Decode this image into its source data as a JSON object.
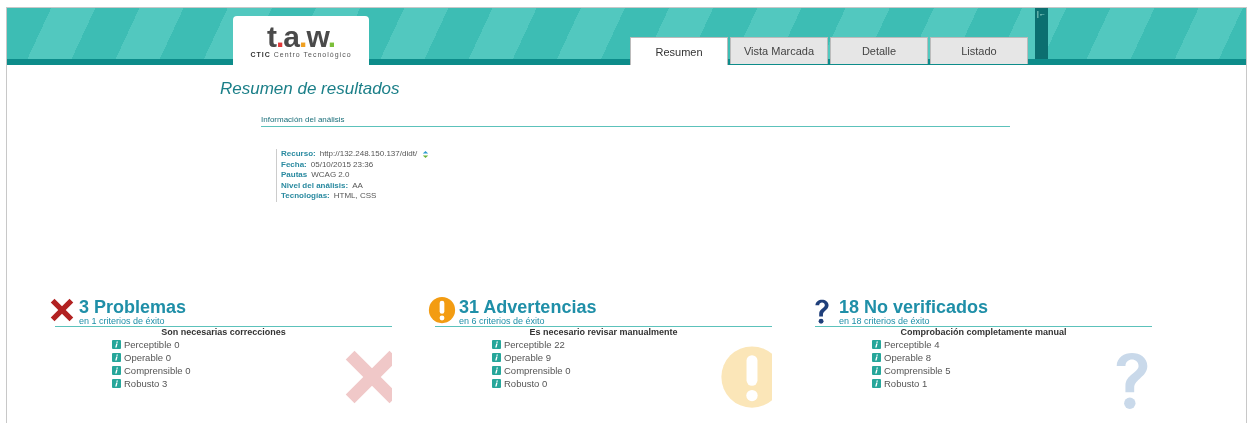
{
  "header": {
    "logo": {
      "wordmark_t": "t",
      "wordmark_dot1": ".",
      "wordmark_a": "a",
      "wordmark_dot2": ".",
      "wordmark_w": "w",
      "wordmark_dot3": ".",
      "tagline_bold": "CTIC",
      "tagline": "Centro Tecnológico"
    },
    "collapse_icon": "|←"
  },
  "tabs": [
    {
      "label": "Resumen",
      "selected": true
    },
    {
      "label": "Vista Marcada",
      "selected": false
    },
    {
      "label": "Detalle",
      "selected": false
    },
    {
      "label": "Listado",
      "selected": false
    }
  ],
  "title": "Resumen de resultados",
  "analysis_info": {
    "heading": "Información del análisis",
    "fields": [
      {
        "label": "Recurso:",
        "value": "http://132.248.150.137/didt/",
        "has_refresh": true
      },
      {
        "label": "Fecha:",
        "value": "05/10/2015 23:36",
        "has_refresh": false
      },
      {
        "label": "Pautas",
        "value": "WCAG 2.0",
        "has_refresh": false
      },
      {
        "label": "Nivel del análisis:",
        "value": "AA",
        "has_refresh": false
      },
      {
        "label": "Tecnologías:",
        "value": "HTML, CSS",
        "has_refresh": false
      }
    ]
  },
  "summaries": [
    {
      "kind": "error",
      "title": "3 Problemas",
      "subtitle": "en 1 criterios de éxito",
      "note": "Son necesarias correcciones",
      "items": [
        "Perceptible 0",
        "Operable 0",
        "Comprensible 0",
        "Robusto 3"
      ]
    },
    {
      "kind": "warning",
      "title": "31 Advertencias",
      "subtitle": "en 6 criterios de éxito",
      "note": "Es necesario revisar manualmente",
      "items": [
        "Perceptible 22",
        "Operable 9",
        "Comprensible 0",
        "Robusto 0"
      ]
    },
    {
      "kind": "unknown",
      "title": "18 No verificados",
      "subtitle": "en 18 criterios de éxito",
      "note": "Comprobación completamente manual",
      "items": [
        "Perceptible 4",
        "Operable 8",
        "Comprensible 5",
        "Robusto 1"
      ]
    }
  ]
}
